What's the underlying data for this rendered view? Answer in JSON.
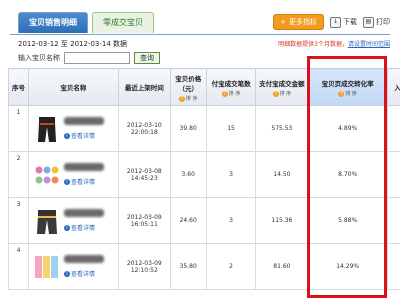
{
  "tabs": [
    {
      "label": "宝贝销售明细",
      "active": true
    },
    {
      "label": "零成交宝贝",
      "active": false
    }
  ],
  "toolbar": {
    "more_label": "更多指标",
    "download_label": "下载",
    "print_label": "打印"
  },
  "date_range": "2012-03-12 至 2012-03-14 数据",
  "notice": {
    "text": "明细数据提供3个月数据，",
    "link": "请设置时间范围"
  },
  "search": {
    "label": "输入宝贝名称",
    "value": "",
    "placeholder": "",
    "button": "查询"
  },
  "table": {
    "headers": [
      "序号",
      "宝贝名称",
      "最近上架时间",
      "宝贝价格（元）",
      "付宝成交笔数",
      "支付宝成交金额",
      "宝贝页成交转化率",
      "入"
    ],
    "sort_label": "排 序",
    "detail_label": "查看详情",
    "rows": [
      {
        "index": "1",
        "date": "2012-03-10",
        "time": "22:00:18",
        "price": "39.80",
        "orders": "15",
        "amount": "575.53",
        "rate": "4.89%"
      },
      {
        "index": "2",
        "date": "2012-03-08",
        "time": "14:45:23",
        "price": "3.60",
        "orders": "3",
        "amount": "14.50",
        "rate": "8.70%"
      },
      {
        "index": "3",
        "date": "2012-03-09",
        "time": "16:05:11",
        "price": "24.60",
        "orders": "3",
        "amount": "115.36",
        "rate": "5.88%"
      },
      {
        "index": "4",
        "date": "2012-03-09",
        "time": "12:10:52",
        "price": "35.80",
        "orders": "2",
        "amount": "81.60",
        "rate": "14.29%"
      }
    ]
  },
  "colors": {
    "highlight": "#d8111a",
    "tab_active": "#2c6fb8",
    "more_button": "#f29b1d"
  }
}
